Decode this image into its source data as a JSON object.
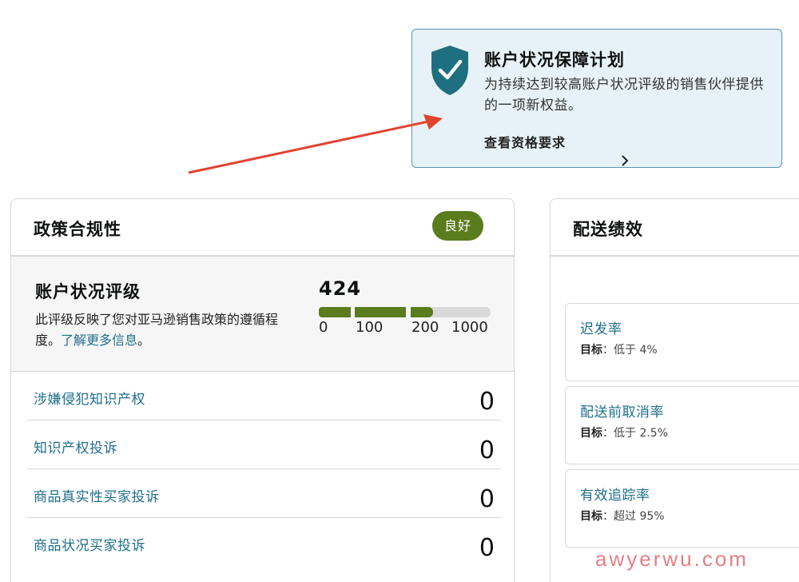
{
  "protection_callout": {
    "title": "账户状况保障计划",
    "description": "为持续达到较高账户状况评级的销售伙伴提供的一项新权益。",
    "link_label": "查看资格要求",
    "icon": "shield-check-icon",
    "colors": {
      "background": "#e6f2f7",
      "border": "#5a95ad",
      "shield": "#1e6f80"
    }
  },
  "annotation_arrow": {
    "color": "#e0442f"
  },
  "policy_card": {
    "title": "政策合规性",
    "status_badge": "良好",
    "badge_color": "#5b7c1d",
    "account_health": {
      "title": "账户状况评级",
      "description": "此评级反映了您对亚马逊销售政策的遵循程度。",
      "learn_more": "了解更多信息",
      "suffix": "。",
      "score": "424",
      "gauge_ticks": [
        "0",
        "100",
        "200",
        "1000"
      ],
      "gauge_color_filled": "#5b7c1d",
      "gauge_color_empty": "#d9d9d9"
    },
    "rows": [
      {
        "label": "涉嫌侵犯知识产权",
        "count": "0"
      },
      {
        "label": "知识产权投诉",
        "count": "0"
      },
      {
        "label": "商品真实性买家投诉",
        "count": "0"
      },
      {
        "label": "商品状况买家投诉",
        "count": "0"
      }
    ]
  },
  "shipping_card": {
    "title": "配送绩效",
    "target_prefix": "目标",
    "metrics": [
      {
        "name": "迟发率",
        "target": "：低于 4%"
      },
      {
        "name": "配送前取消率",
        "target": "：低于 2.5%"
      },
      {
        "name": "有效追踪率",
        "target": "：超过 95%"
      }
    ]
  },
  "watermark": "awyerwu.com",
  "link_color": "#1f6f8b"
}
